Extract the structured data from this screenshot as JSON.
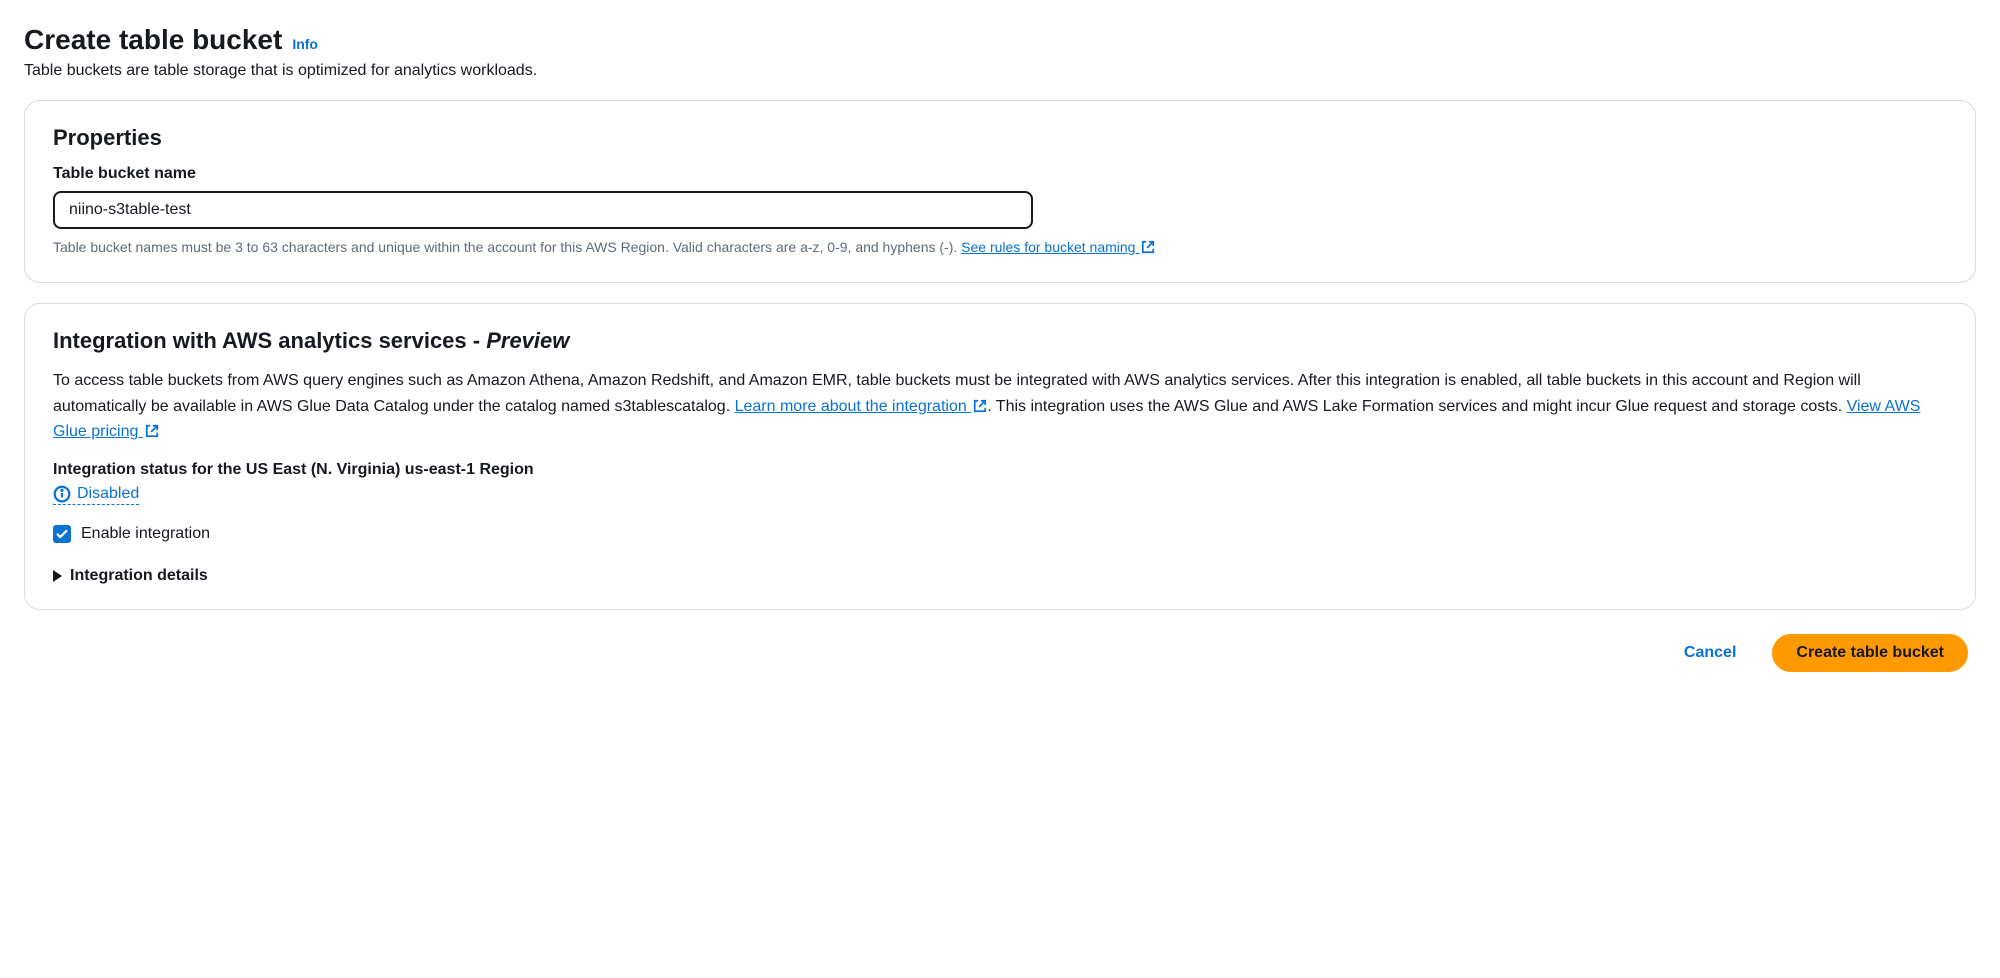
{
  "header": {
    "title": "Create table bucket",
    "info_label": "Info",
    "description": "Table buckets are table storage that is optimized for analytics workloads."
  },
  "properties": {
    "heading": "Properties",
    "name_label": "Table bucket name",
    "name_value": "niino-s3table-test",
    "hint_prefix": "Table bucket names must be 3 to 63 characters and unique within the account for this AWS Region. Valid characters are a-z, 0-9, and hyphens (-). ",
    "rules_link": "See rules for bucket naming"
  },
  "integration": {
    "heading_prefix": "Integration with AWS analytics services - ",
    "heading_preview": "Preview",
    "desc_part1": "To access table buckets from AWS query engines such as Amazon Athena, Amazon Redshift, and Amazon EMR, table buckets must be integrated with AWS analytics services. After this integration is enabled, all table buckets in this account and Region will automatically be available in AWS Glue Data Catalog under the catalog named s3tablescatalog. ",
    "learn_link": "Learn more about the integration",
    "desc_part2": ". This integration uses the AWS Glue and AWS Lake Formation services and might incur Glue request and storage costs. ",
    "pricing_link": "View AWS Glue pricing",
    "status_label": "Integration status for the US East (N. Virginia) us-east-1 Region",
    "status_value": "Disabled",
    "checkbox_label": "Enable integration",
    "details_label": "Integration details"
  },
  "actions": {
    "cancel": "Cancel",
    "create": "Create table bucket"
  }
}
